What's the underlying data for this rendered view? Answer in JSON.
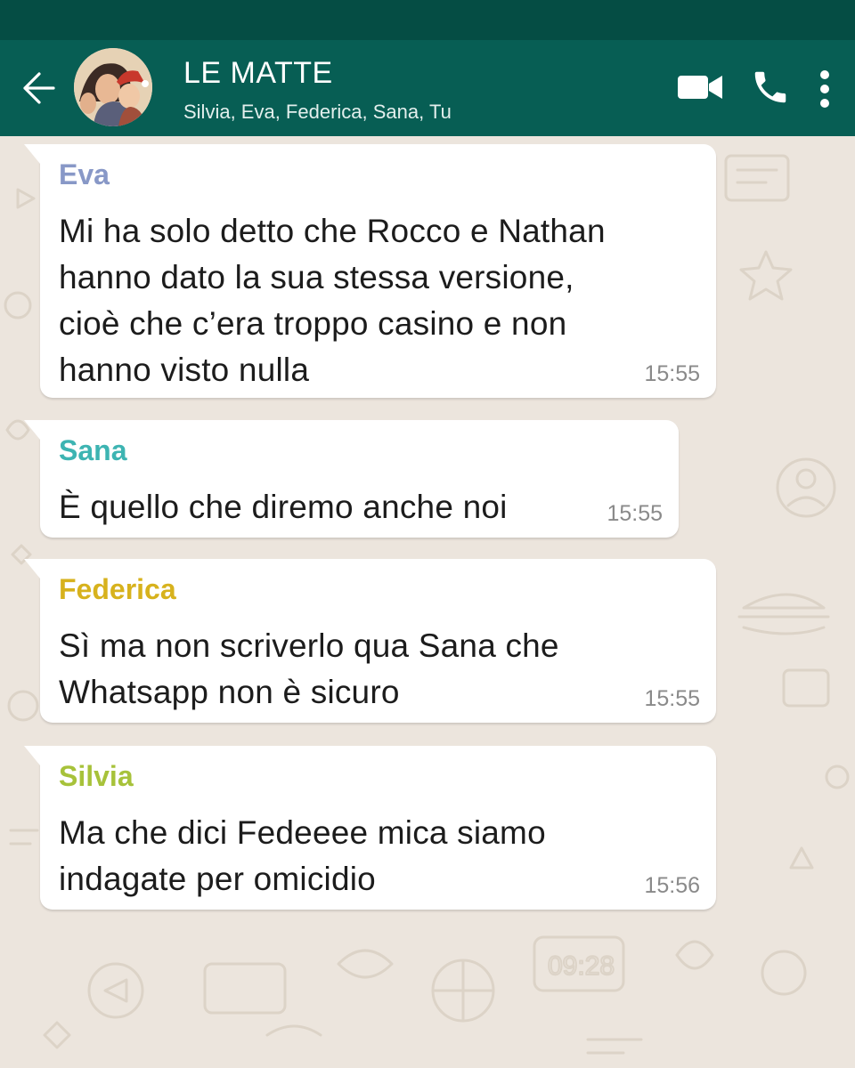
{
  "header": {
    "title": "LE MATTE",
    "subtitle": "Silvia, Eva, Federica, Sana, Tu",
    "icons": {
      "back": "arrow-left-icon",
      "video": "video-camera-icon",
      "phone": "phone-icon",
      "menu": "more-vertical-icon"
    },
    "colors": {
      "status_bar": "#054d44",
      "header_bg": "#075e54"
    }
  },
  "messages": [
    {
      "sender": "Eva",
      "sender_color": "#8898c7",
      "text": "Mi ha solo detto che Rocco e Nathan\nhanno dato la sua stessa versione,\ncioè che c’era troppo casino e non\nhanno visto nulla",
      "time": "15:55"
    },
    {
      "sender": "Sana",
      "sender_color": "#3db4b2",
      "text": "È quello che diremo anche noi",
      "time": "15:55"
    },
    {
      "sender": "Federica",
      "sender_color": "#d7b21d",
      "text": "Sì ma non scriverlo qua Sana che\nWhatsapp non è sicuro",
      "time": "15:55"
    },
    {
      "sender": "Silvia",
      "sender_color": "#a7c23a",
      "text": "Ma che dici Fedeeee mica siamo\nindagate per omicidio",
      "time": "15:56"
    }
  ],
  "wallpaper_color": "#ece5dd"
}
